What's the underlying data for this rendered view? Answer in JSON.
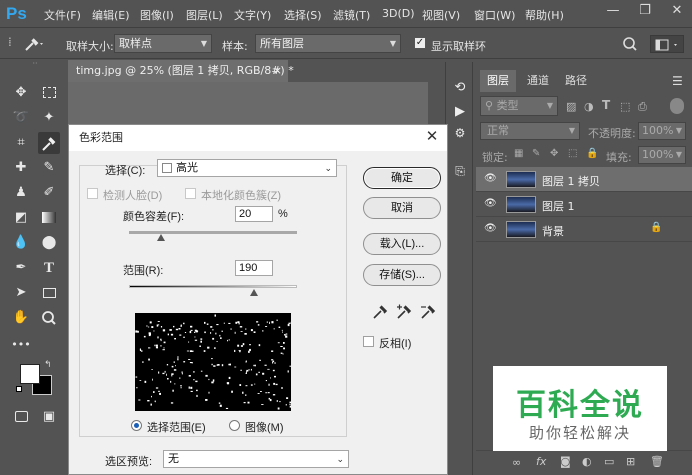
{
  "app": {
    "logo_text": "Ps"
  },
  "menubar": {
    "items": [
      "文件(F)",
      "编辑(E)",
      "图像(I)",
      "图层(L)",
      "文字(Y)",
      "选择(S)",
      "滤镜(T)",
      "3D(D)",
      "视图(V)",
      "窗口(W)",
      "帮助(H)"
    ],
    "window_controls": {
      "minimize": "—",
      "restore": "❐",
      "close": "✕"
    }
  },
  "options_bar": {
    "sample_size_label": "取样大小:",
    "sample_size_value": "取样点",
    "sample_label": "样本:",
    "sample_value": "所有图层",
    "show_ring_label": "显示取样环",
    "show_ring_checked": true
  },
  "document": {
    "tab_title": "timg.jpg @ 25% (图层 1 拷贝, RGB/8#) *",
    "tab_close": "×"
  },
  "dialog": {
    "title": "色彩范围",
    "close": "✕",
    "select_label": "选择(C):",
    "select_value": "高光",
    "detect_faces_label": "检测人脸(D)",
    "localized_label": "本地化颜色簇(Z)",
    "fuzziness_label": "颜色容差(F):",
    "fuzziness_value": "20",
    "fuzziness_unit": "%",
    "range_label": "范围(R):",
    "range_value": "190",
    "fuzziness_slider_fraction": 0.19,
    "range_slider_fraction": 0.745,
    "radio_selection_label": "选择范围(E)",
    "radio_image_label": "图像(M)",
    "radio_selected": "selection",
    "preview_label": "选区预览:",
    "preview_value": "无",
    "buttons": {
      "ok": "确定",
      "cancel": "取消",
      "load": "载入(L)...",
      "save": "存储(S)..."
    },
    "invert_label": "反相(I)",
    "invert_checked": false
  },
  "layers_panel": {
    "tabs": [
      "图层",
      "通道",
      "路径"
    ],
    "active_tab": "图层",
    "filter_kind": "类型",
    "blend_mode": "正常",
    "opacity_label": "不透明度:",
    "opacity_value": "100%",
    "lock_label": "锁定:",
    "fill_label": "填充:",
    "fill_value": "100%",
    "layers": [
      {
        "name": "图层 1 拷贝",
        "selected": true,
        "locked": false
      },
      {
        "name": "图层 1",
        "selected": false,
        "locked": false
      },
      {
        "name": "背景",
        "selected": false,
        "locked": true
      }
    ]
  },
  "watermark": {
    "title": "百科全说",
    "subtitle": "助你轻松解决"
  },
  "colors": {
    "ui_bg": "#535353",
    "dialog_bg": "#f0f0f0",
    "ps_blue": "#32a8f0",
    "watermark_green": "#2eab52"
  }
}
